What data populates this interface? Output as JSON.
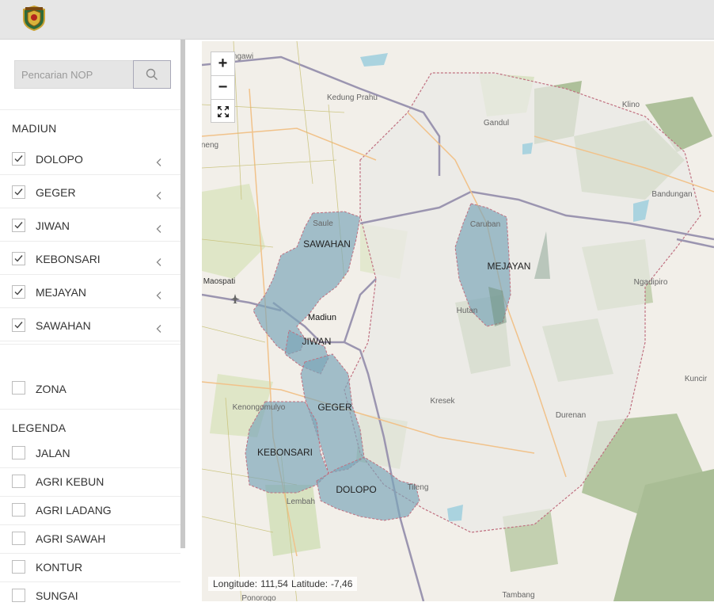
{
  "header": {
    "logo_icon": "regency-emblem-icon"
  },
  "search": {
    "placeholder": "Pencarian NOP",
    "icon": "search-icon"
  },
  "layers": {
    "group_title": "MADIUN",
    "items": [
      {
        "label": "DOLOPO",
        "checked": true
      },
      {
        "label": "GEGER",
        "checked": true
      },
      {
        "label": "JIWAN",
        "checked": true
      },
      {
        "label": "KEBONSARI",
        "checked": true
      },
      {
        "label": "MEJAYAN",
        "checked": true
      },
      {
        "label": "SAWAHAN",
        "checked": true
      }
    ]
  },
  "zona": {
    "label": "ZONA",
    "checked": false
  },
  "legend": {
    "title": "LEGENDA",
    "items": [
      {
        "label": "JALAN",
        "checked": false
      },
      {
        "label": "AGRI KEBUN",
        "checked": false
      },
      {
        "label": "AGRI LADANG",
        "checked": false
      },
      {
        "label": "AGRI SAWAH",
        "checked": false
      },
      {
        "label": "KONTUR",
        "checked": false
      },
      {
        "label": "SUNGAI",
        "checked": false
      }
    ]
  },
  "map": {
    "zoom_in": "+",
    "zoom_out": "−",
    "fullscreen_icon": "fullscreen-icon",
    "district_labels": [
      "SAWAHAN",
      "MEJAYAN",
      "JIWAN",
      "GEGER",
      "KEBONSARI",
      "DOLOPO"
    ],
    "place_labels": [
      "Madiun",
      "Caruban",
      "Maospati",
      "Kedung Prahu",
      "Gandul",
      "Klino",
      "Bandungan",
      "Ngadipiro",
      "Hutan",
      "Kuncir",
      "Kresek",
      "Durenan",
      "Kenongomulyo",
      "Tileng",
      "Lembah",
      "Tambang",
      "Ponorogo",
      "ngawi",
      "neng",
      "Saule"
    ],
    "region_fill": "#7ba5b8",
    "boundary_color": "#c07080",
    "forest_color": "#aec09a",
    "road_color": "#9b95b0",
    "coords": {
      "longitude_label": "Longitude:",
      "longitude": "111,54",
      "latitude_label": "Latitude:",
      "latitude": "-7,46"
    }
  }
}
